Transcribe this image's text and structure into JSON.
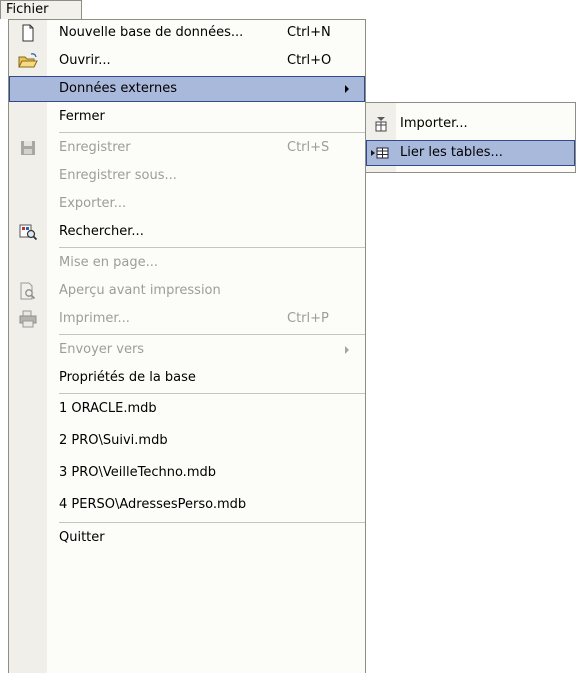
{
  "menu_title": "Fichier",
  "items": {
    "nouvelle": {
      "label": "Nouvelle base de données...",
      "shortcut": "Ctrl+N"
    },
    "ouvrir": {
      "label": "Ouvrir...",
      "shortcut": "Ctrl+O"
    },
    "donnees_externes": {
      "label": "Données externes"
    },
    "fermer": {
      "label": "Fermer"
    },
    "enregistrer": {
      "label": "Enregistrer",
      "shortcut": "Ctrl+S"
    },
    "enregistrer_sous": {
      "label": "Enregistrer sous..."
    },
    "exporter": {
      "label": "Exporter..."
    },
    "rechercher": {
      "label": "Rechercher..."
    },
    "mise_en_page": {
      "label": "Mise en page..."
    },
    "apercu": {
      "label": "Aperçu avant impression"
    },
    "imprimer": {
      "label": "Imprimer...",
      "shortcut": "Ctrl+P"
    },
    "envoyer_vers": {
      "label": "Envoyer vers"
    },
    "proprietes": {
      "label": "Propriétés de la base"
    },
    "recent1": {
      "label": "1 ORACLE.mdb"
    },
    "recent2": {
      "label": "2 PRO\\Suivi.mdb"
    },
    "recent3": {
      "label": "3 PRO\\VeilleTechno.mdb"
    },
    "recent4": {
      "label": "4 PERSO\\AdressesPerso.mdb"
    },
    "quitter": {
      "label": "Quitter"
    }
  },
  "submenu": {
    "importer": {
      "label": "Importer..."
    },
    "lier_tables": {
      "label": "Lier les tables..."
    }
  },
  "colors": {
    "highlight": "#a9b9dc",
    "highlight_border": "#314a8a",
    "disabled_text": "#9d9d98"
  }
}
